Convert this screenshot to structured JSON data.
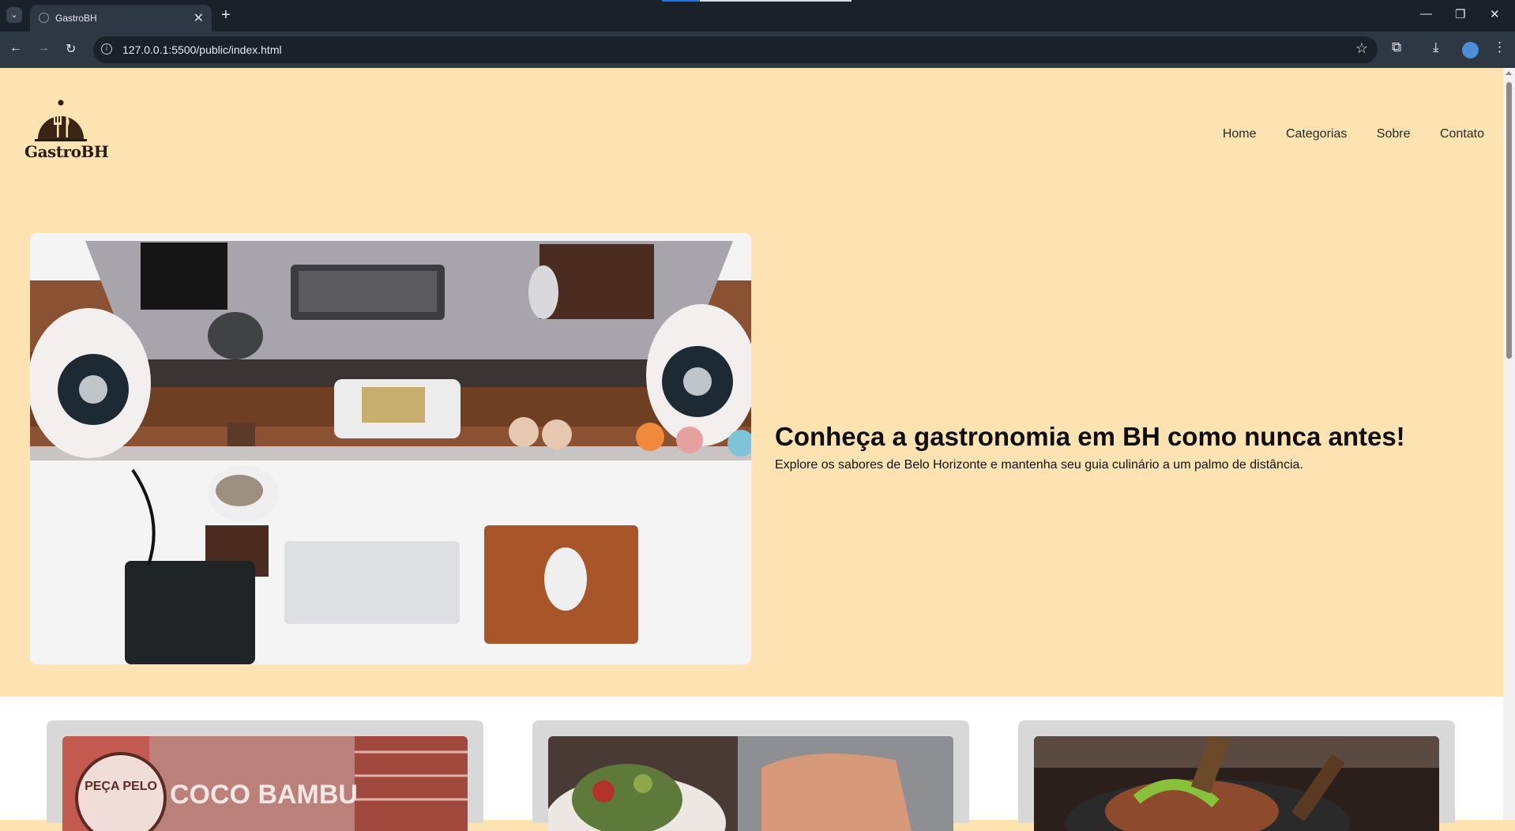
{
  "browser": {
    "tab_title": "GastroBH",
    "url": "127.0.0.1:5500/public/index.html",
    "icons": [
      "tab-search-icon",
      "close-icon",
      "new-tab-icon",
      "back-icon",
      "forward-icon",
      "reload-icon",
      "site-info-icon",
      "bookmark-star-icon",
      "extensions-icon",
      "download-icon",
      "profile-avatar-icon",
      "menu-icon",
      "minimize-icon",
      "restore-icon",
      "window-close-icon"
    ]
  },
  "site": {
    "logo_text": "GastroBH",
    "nav": [
      "Home",
      "Categorias",
      "Sobre",
      "Contato"
    ]
  },
  "hero": {
    "title": "Conheça a gastronomia em BH como nunca antes!",
    "subtitle": "Explore os sabores de Belo Horizonte e mantenha seu guia culinário a um palmo de distância."
  },
  "cards": {
    "card1_sign_text": "COCO BAMBU",
    "card1_badge_text": "PEÇA PELO"
  },
  "colors": {
    "page_bg": "#fde3b1",
    "band_bg": "#ffffff",
    "card_bg": "#d8d8d8",
    "chrome_dark": "#1a2129",
    "chrome_toolbar": "#2e3744"
  }
}
